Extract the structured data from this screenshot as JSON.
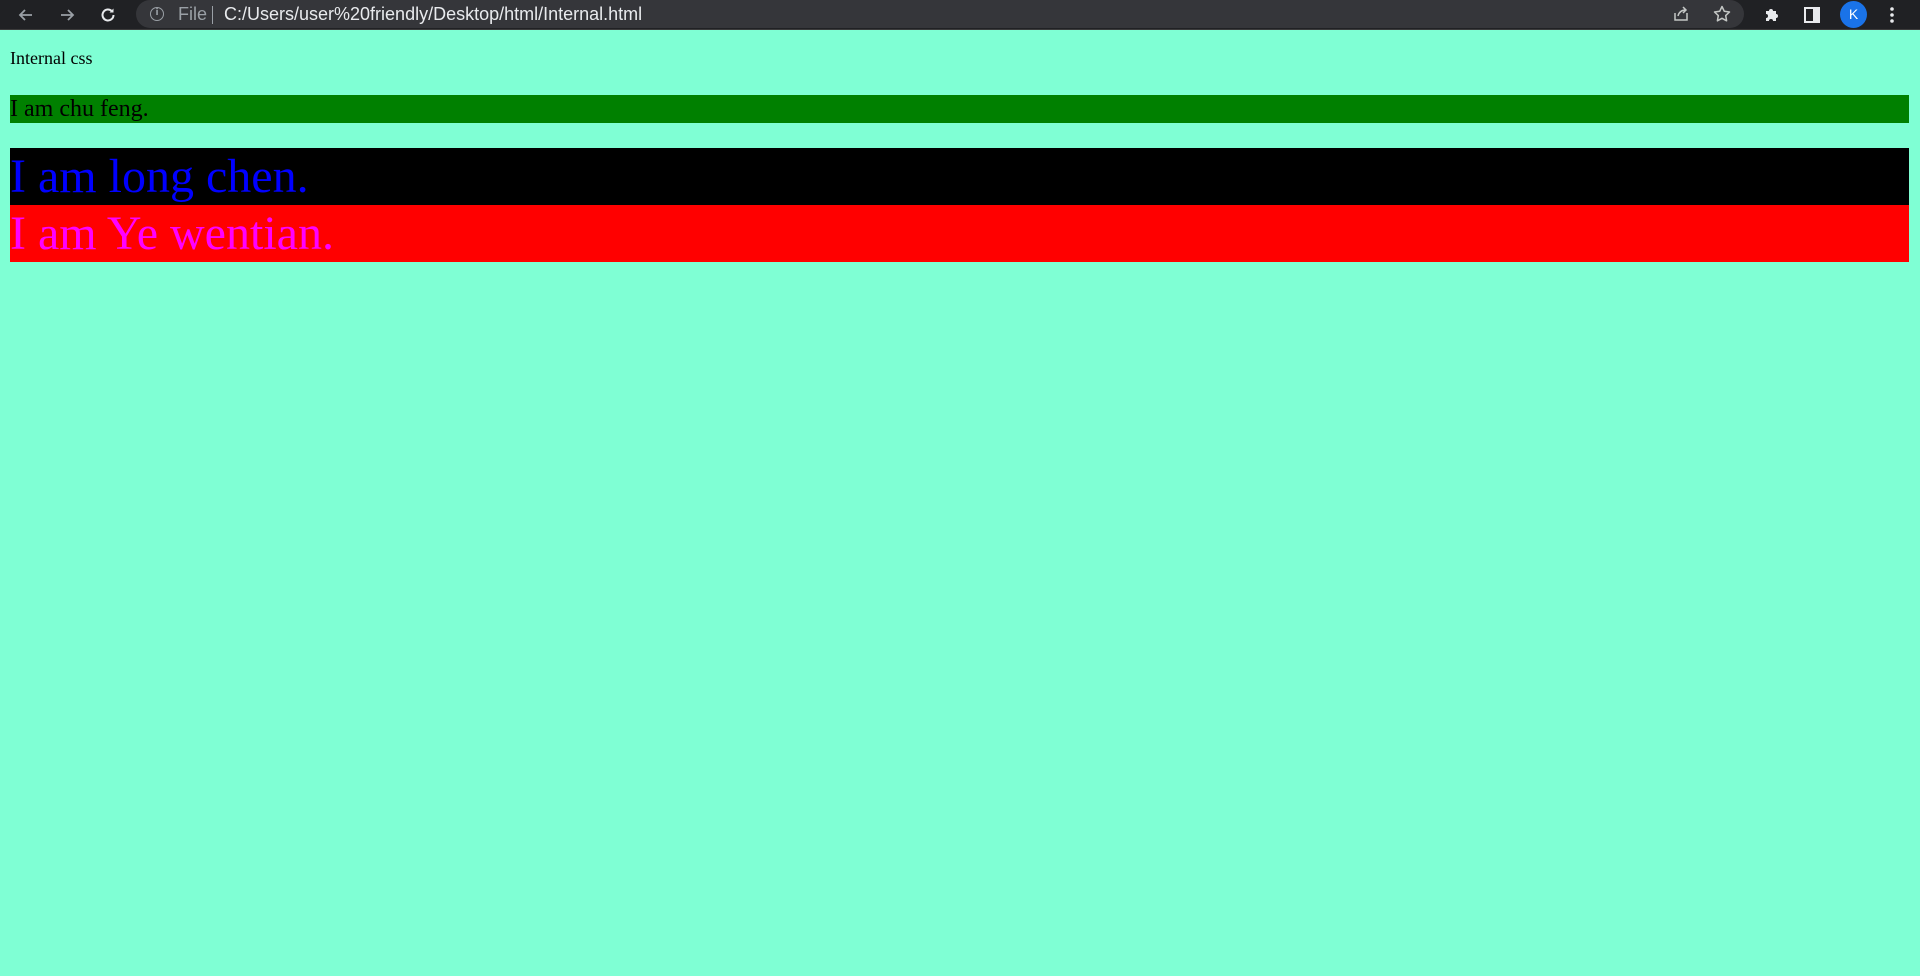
{
  "browser": {
    "scheme_label": "File",
    "url": "C:/Users/user%20friendly/Desktop/html/Internal.html",
    "profile_initial": "K",
    "icons": {
      "back": "arrow-left",
      "forward": "arrow-right",
      "reload": "reload",
      "info": "info-circle",
      "share": "share",
      "bookmark": "star",
      "extensions": "puzzle-piece",
      "side_panel": "side-panel",
      "menu": "vertical-dots"
    },
    "colors": {
      "toolbar": "#202124",
      "omnibox": "#35363a",
      "avatar": "#1a73e8"
    }
  },
  "page": {
    "background": "#7fffd4",
    "heading": "Internal css",
    "paragraphs": [
      {
        "text": "I am chu feng.",
        "background": "#008000",
        "color": "#000000"
      },
      {
        "text": "I am long chen.",
        "background": "#000000",
        "color": "#0000ff"
      },
      {
        "text": "I am Ye wentian.",
        "background": "#ff0000",
        "color": "#ff00ff"
      }
    ]
  }
}
